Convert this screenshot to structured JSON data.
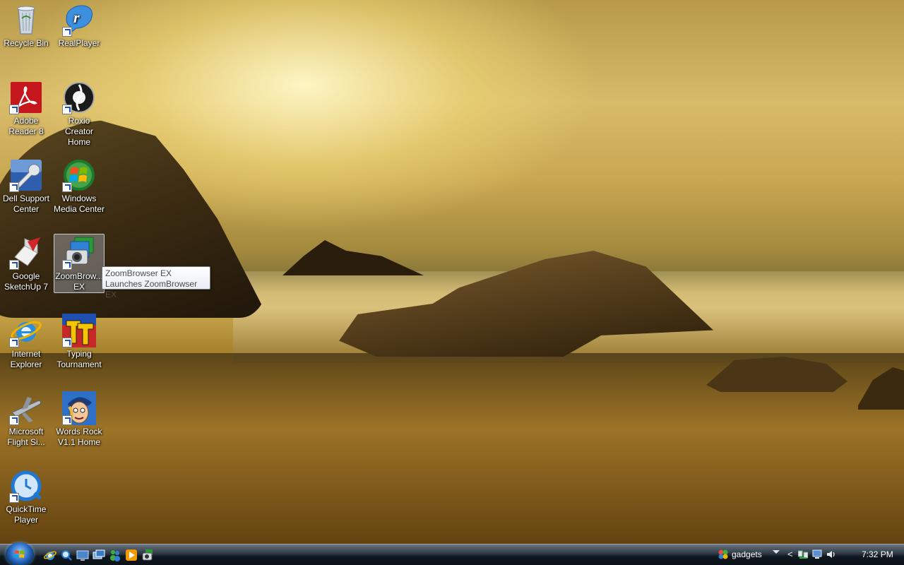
{
  "desktop_icons": [
    {
      "name": "recycle-bin",
      "label": "Recycle Bin",
      "icon": "recycle-bin-icon",
      "shortcut": false
    },
    {
      "name": "realplayer",
      "label": "RealPlayer",
      "icon": "realplayer-icon",
      "shortcut": true
    },
    {
      "name": "adobe-reader",
      "label": "Adobe Reader 8",
      "icon": "adobe-reader-icon",
      "shortcut": true
    },
    {
      "name": "roxio-creator",
      "label": "Roxio Creator Home",
      "icon": "roxio-icon",
      "shortcut": true
    },
    {
      "name": "dell-support",
      "label": "Dell Support Center",
      "icon": "wrench-icon",
      "shortcut": true
    },
    {
      "name": "windows-media-center",
      "label": "Windows Media Center",
      "icon": "windows-logo-icon",
      "shortcut": true
    },
    {
      "name": "google-sketchup",
      "label": "Google SketchUp 7",
      "icon": "sketchup-icon",
      "shortcut": true
    },
    {
      "name": "zoombrowser",
      "label": "ZoomBrow... EX",
      "icon": "camera-icon",
      "shortcut": true,
      "selected": true
    },
    {
      "name": "internet-explorer",
      "label": "Internet Explorer",
      "icon": "internet-explorer-icon",
      "shortcut": true
    },
    {
      "name": "typing-tournament",
      "label": "Typing Tournament",
      "icon": "typing-tournament-icon",
      "shortcut": true
    },
    {
      "name": "flight-simulator",
      "label": "Microsoft Flight Si...",
      "icon": "airplane-icon",
      "shortcut": true
    },
    {
      "name": "words-rock",
      "label": "Words Rock V1.1 Home",
      "icon": "cartoon-face-icon",
      "shortcut": true
    },
    {
      "name": "quicktime",
      "label": "QuickTime Player",
      "icon": "quicktime-icon",
      "shortcut": true
    }
  ],
  "tooltip": {
    "title": "ZoomBrowser EX",
    "description": "Launches ZoomBrowser EX"
  },
  "taskbar": {
    "gadgets_label": "gadgets",
    "clock": "7:32 PM",
    "quicklaunch": [
      "internet-explorer-icon",
      "search-icon",
      "show-desktop-icon",
      "switch-windows-icon",
      "messenger-icon",
      "media-player-icon",
      "camera-icon"
    ],
    "tray": [
      "network-icon",
      "monitor-icon",
      "volume-icon"
    ]
  },
  "colors": {
    "taskbar": "#101820",
    "selection": "#c8d2e6",
    "shortcut_arrow": "#1d4fb8"
  }
}
